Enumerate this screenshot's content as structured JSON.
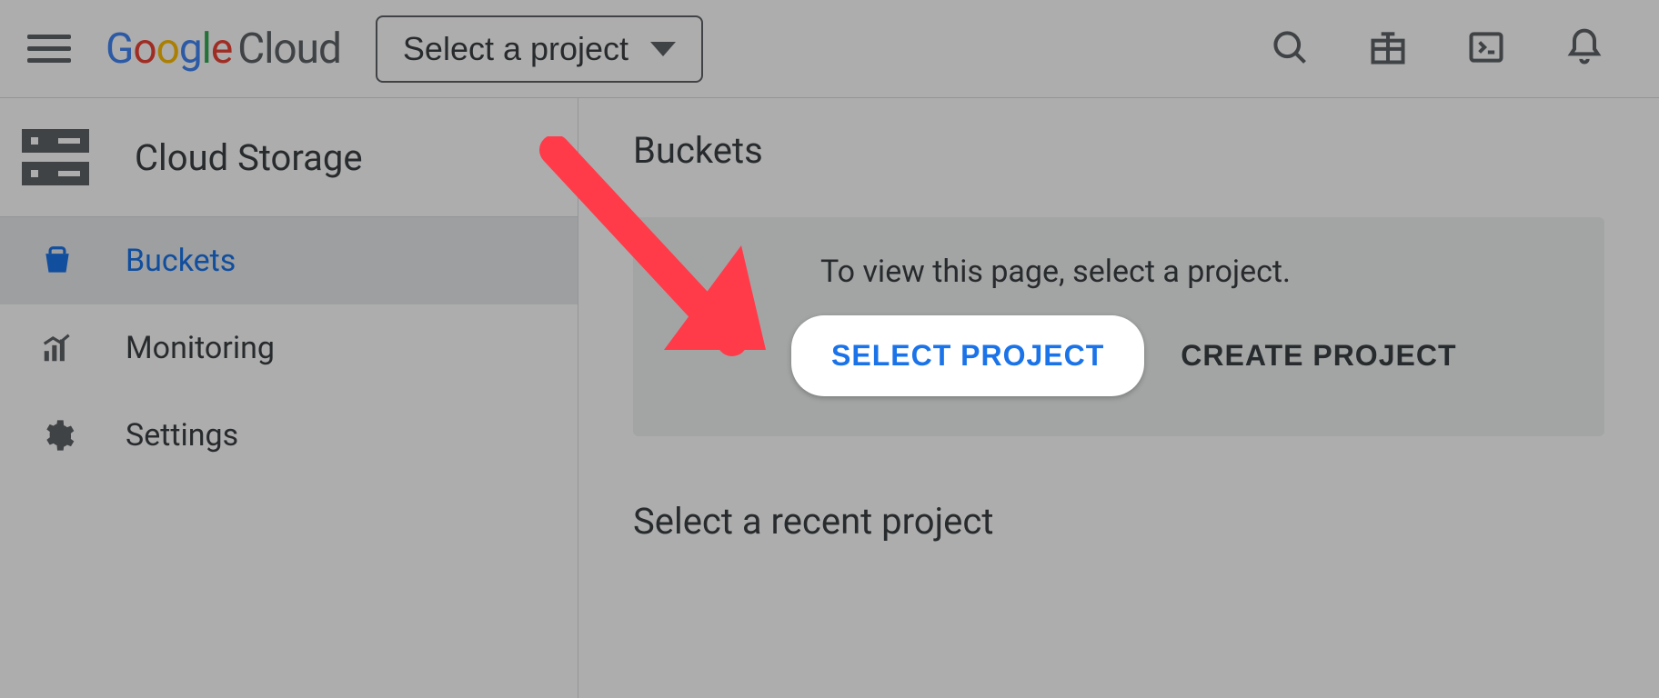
{
  "header": {
    "project_selector_label": "Select a project",
    "brand_product": "Cloud"
  },
  "sidenav": {
    "title": "Cloud Storage",
    "items": [
      {
        "label": "Buckets",
        "icon": "bucket-icon",
        "active": true
      },
      {
        "label": "Monitoring",
        "icon": "monitoring-icon",
        "active": false
      },
      {
        "label": "Settings",
        "icon": "gear-icon",
        "active": false
      }
    ]
  },
  "content": {
    "page_title": "Buckets",
    "prompt_text": "To view this page, select a project.",
    "select_project_label": "SELECT PROJECT",
    "create_project_label": "CREATE PROJECT",
    "recent_heading": "Select a recent project"
  }
}
